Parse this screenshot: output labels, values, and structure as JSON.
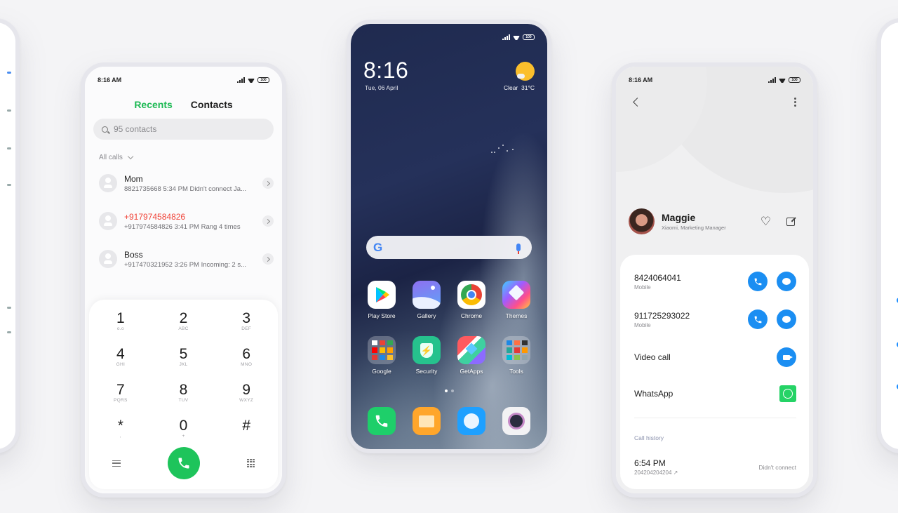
{
  "status_bar": {
    "time": "8:16 AM",
    "battery": "100"
  },
  "dialer": {
    "tabs": [
      {
        "label": "Recents",
        "active": true
      },
      {
        "label": "Contacts",
        "active": false
      }
    ],
    "search_placeholder": "95 contacts",
    "filter_label": "All calls",
    "calls": [
      {
        "name": "Mom",
        "detail": "8821735668  5:34 PM Didn't connect  Ja...",
        "missed": false
      },
      {
        "name": "+917974584826",
        "detail": "+917974584826  3:41 PM Rang 4 times",
        "missed": true
      },
      {
        "name": "Boss",
        "detail": "+917470321952  3:26 PM Incoming: 2 s...",
        "missed": false
      }
    ],
    "keys": [
      {
        "digit": "1",
        "letters": "o.o"
      },
      {
        "digit": "2",
        "letters": "ABC"
      },
      {
        "digit": "3",
        "letters": "DEF"
      },
      {
        "digit": "4",
        "letters": "GHI"
      },
      {
        "digit": "5",
        "letters": "JKL"
      },
      {
        "digit": "6",
        "letters": "MNO"
      },
      {
        "digit": "7",
        "letters": "PQRS"
      },
      {
        "digit": "8",
        "letters": "TUV"
      },
      {
        "digit": "9",
        "letters": "WXYZ"
      },
      {
        "digit": "*",
        "letters": ","
      },
      {
        "digit": "0",
        "letters": "+"
      },
      {
        "digit": "#",
        "letters": ""
      }
    ],
    "accent_color": "#1ec45b"
  },
  "home": {
    "clock": "8:16",
    "date": "Tue, 06 April",
    "weather": {
      "condition": "Clear",
      "temperature": "31°C"
    },
    "search_logo": "G",
    "apps_row1": [
      {
        "label": "Play Store",
        "icon": "play-store-icon"
      },
      {
        "label": "Gallery",
        "icon": "gallery-icon"
      },
      {
        "label": "Chrome",
        "icon": "chrome-icon"
      },
      {
        "label": "Themes",
        "icon": "themes-icon"
      }
    ],
    "apps_row2": [
      {
        "label": "Google",
        "icon": "google-folder-icon"
      },
      {
        "label": "Security",
        "icon": "security-icon"
      },
      {
        "label": "GetApps",
        "icon": "getapps-icon"
      },
      {
        "label": "Tools",
        "icon": "tools-folder-icon"
      }
    ],
    "dock": [
      {
        "icon": "phone-icon"
      },
      {
        "icon": "messages-icon"
      },
      {
        "icon": "browser-icon"
      },
      {
        "icon": "camera-icon"
      }
    ],
    "page_count": 2,
    "current_page": 1
  },
  "contact": {
    "name": "Maggie",
    "subtitle": "Xiaomi, Marketing Manager",
    "numbers": [
      {
        "number": "8424064041",
        "type": "Mobile"
      },
      {
        "number": "911725293022",
        "type": "Mobile"
      }
    ],
    "video_call_label": "Video call",
    "whatsapp_label": "WhatsApp",
    "call_history_label": "Call history",
    "history": [
      {
        "time": "6:54 PM",
        "number": "204204204204 ↗",
        "status": "Didn't connect"
      }
    ],
    "accent_color": "#1b8ef2"
  }
}
